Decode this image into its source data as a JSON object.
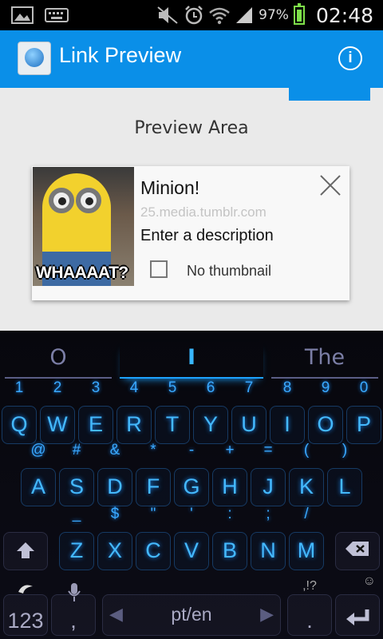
{
  "status_bar": {
    "left_icons": [
      "image-icon",
      "keyboard-icon"
    ],
    "right_icons": [
      "mute-icon",
      "alarm-icon",
      "wifi-icon",
      "signal-icon"
    ],
    "battery_percent": "97%",
    "time": "02:48"
  },
  "action_bar": {
    "title": "Link Preview",
    "info_label": "i"
  },
  "content": {
    "preview_heading": "Preview Area",
    "card": {
      "title": "Minion!",
      "url": "25.media.tumblr.com",
      "description": "Enter a description",
      "thumbnail_caption": "WHAAAAT?",
      "no_thumbnail_label": "No thumbnail",
      "no_thumbnail_checked": false
    }
  },
  "keyboard": {
    "suggestions": [
      "O",
      "I",
      "The"
    ],
    "row1": {
      "keys": [
        "Q",
        "W",
        "E",
        "R",
        "T",
        "Y",
        "U",
        "I",
        "O",
        "P"
      ],
      "hints": [
        "1",
        "2",
        "3",
        "4",
        "5",
        "6",
        "7",
        "8",
        "9",
        "0"
      ]
    },
    "row2": {
      "keys": [
        "A",
        "S",
        "D",
        "F",
        "G",
        "H",
        "J",
        "K",
        "L"
      ],
      "hints": [
        "@",
        "#",
        "&",
        "*",
        "-",
        "+",
        "=",
        "(",
        ")"
      ]
    },
    "row3": {
      "keys": [
        "Z",
        "X",
        "C",
        "V",
        "B",
        "N",
        "M"
      ],
      "hints": [
        "_",
        "$",
        "\"",
        "'",
        ":",
        ";",
        "/"
      ]
    },
    "bottom": {
      "num_label": "123",
      "comma": ",",
      "space_label": "pt/en",
      "period": ".",
      "period_hint": ",!?"
    },
    "colors": {
      "key_glow": "#44b9ff",
      "accent": "#0a8fe8"
    }
  }
}
